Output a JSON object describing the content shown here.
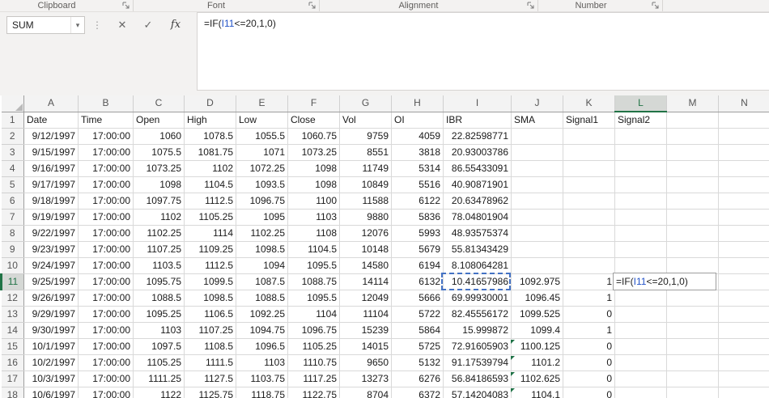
{
  "ribbon": {
    "groups": [
      {
        "label": "Clipboard"
      },
      {
        "label": "Font"
      },
      {
        "label": "Alignment"
      },
      {
        "label": "Number"
      }
    ]
  },
  "icons": {
    "dropdown": "▾",
    "grip": "⋮",
    "cancel": "✕",
    "enter": "✓",
    "fx": "fx"
  },
  "formula_bar": {
    "name_box_value": "SUM",
    "formula": {
      "pre": "=IF(",
      "ref": "I11",
      "post": "<=20,1,0)"
    }
  },
  "colors": {
    "accent_green": "#217346",
    "reference_blue": "#2353c8",
    "marching_ants_blue": "#4472c4"
  },
  "grid": {
    "columns": [
      "A",
      "B",
      "C",
      "D",
      "E",
      "F",
      "G",
      "H",
      "I",
      "J",
      "K",
      "L",
      "M",
      "N"
    ],
    "selected_column": "L",
    "selected_row": 11,
    "header_row": [
      "Date",
      "Time",
      "Open",
      "High",
      "Low",
      "Close",
      "Vol",
      "OI",
      "IBR",
      "SMA",
      "Signal1",
      "Signal2",
      "",
      ""
    ],
    "rows": [
      {
        "n": 2,
        "cells": [
          "9/12/1997",
          "17:00:00",
          "1060",
          "1078.5",
          "1055.5",
          "1060.75",
          "9759",
          "4059",
          "22.82598771",
          "",
          "",
          ""
        ]
      },
      {
        "n": 3,
        "cells": [
          "9/15/1997",
          "17:00:00",
          "1075.5",
          "1081.75",
          "1071",
          "1073.25",
          "8551",
          "3818",
          "20.93003786",
          "",
          "",
          ""
        ]
      },
      {
        "n": 4,
        "cells": [
          "9/16/1997",
          "17:00:00",
          "1073.25",
          "1102",
          "1072.25",
          "1098",
          "11749",
          "5314",
          "86.55433091",
          "",
          "",
          ""
        ]
      },
      {
        "n": 5,
        "cells": [
          "9/17/1997",
          "17:00:00",
          "1098",
          "1104.5",
          "1093.5",
          "1098",
          "10849",
          "5516",
          "40.90871901",
          "",
          "",
          ""
        ]
      },
      {
        "n": 6,
        "cells": [
          "9/18/1997",
          "17:00:00",
          "1097.75",
          "1112.5",
          "1096.75",
          "1100",
          "11588",
          "6122",
          "20.63478962",
          "",
          "",
          ""
        ]
      },
      {
        "n": 7,
        "cells": [
          "9/19/1997",
          "17:00:00",
          "1102",
          "1105.25",
          "1095",
          "1103",
          "9880",
          "5836",
          "78.04801904",
          "",
          "",
          ""
        ]
      },
      {
        "n": 8,
        "cells": [
          "9/22/1997",
          "17:00:00",
          "1102.25",
          "1114",
          "1102.25",
          "1108",
          "12076",
          "5993",
          "48.93575374",
          "",
          "",
          ""
        ]
      },
      {
        "n": 9,
        "cells": [
          "9/23/1997",
          "17:00:00",
          "1107.25",
          "1109.25",
          "1098.5",
          "1104.5",
          "10148",
          "5679",
          "55.81343429",
          "",
          "",
          ""
        ]
      },
      {
        "n": 10,
        "cells": [
          "9/24/1997",
          "17:00:00",
          "1103.5",
          "1112.5",
          "1094",
          "1095.5",
          "14580",
          "6194",
          "8.108064281",
          "",
          "",
          ""
        ]
      },
      {
        "n": 11,
        "cells": [
          "9/25/1997",
          "17:00:00",
          "1095.75",
          "1099.5",
          "1087.5",
          "1088.75",
          "14114",
          "6132",
          "10.41657986",
          "1092.975",
          "1",
          ""
        ]
      },
      {
        "n": 12,
        "cells": [
          "9/26/1997",
          "17:00:00",
          "1088.5",
          "1098.5",
          "1088.5",
          "1095.5",
          "12049",
          "5666",
          "69.99930001",
          "1096.45",
          "1",
          ""
        ]
      },
      {
        "n": 13,
        "cells": [
          "9/29/1997",
          "17:00:00",
          "1095.25",
          "1106.5",
          "1092.25",
          "1104",
          "11104",
          "5722",
          "82.45556172",
          "1099.525",
          "0",
          ""
        ]
      },
      {
        "n": 14,
        "cells": [
          "9/30/1997",
          "17:00:00",
          "1103",
          "1107.25",
          "1094.75",
          "1096.75",
          "15239",
          "5864",
          "15.999872",
          "1099.4",
          "1",
          ""
        ]
      },
      {
        "n": 15,
        "cells": [
          "10/1/1997",
          "17:00:00",
          "1097.5",
          "1108.5",
          "1096.5",
          "1105.25",
          "14015",
          "5725",
          "72.91605903",
          "1100.125",
          "0",
          ""
        ]
      },
      {
        "n": 16,
        "cells": [
          "10/2/1997",
          "17:00:00",
          "1105.25",
          "1111.5",
          "1103",
          "1110.75",
          "9650",
          "5132",
          "91.17539794",
          "1101.2",
          "0",
          ""
        ]
      },
      {
        "n": 17,
        "cells": [
          "10/3/1997",
          "17:00:00",
          "1111.25",
          "1127.5",
          "1103.75",
          "1117.25",
          "13273",
          "6276",
          "56.84186593",
          "1102.625",
          "0",
          ""
        ]
      },
      {
        "n": 18,
        "cells": [
          "10/6/1997",
          "17:00:00",
          "1122",
          "1125.75",
          "1118.75",
          "1122.75",
          "8704",
          "6372",
          "57.14204083",
          "1104.1",
          "0",
          ""
        ]
      }
    ],
    "edit_cell": "L11",
    "referenced_cell": "I11",
    "green_flags": [
      {
        "col": "J",
        "row": 15
      },
      {
        "col": "J",
        "row": 16
      },
      {
        "col": "J",
        "row": 17
      },
      {
        "col": "J",
        "row": 18
      }
    ]
  }
}
